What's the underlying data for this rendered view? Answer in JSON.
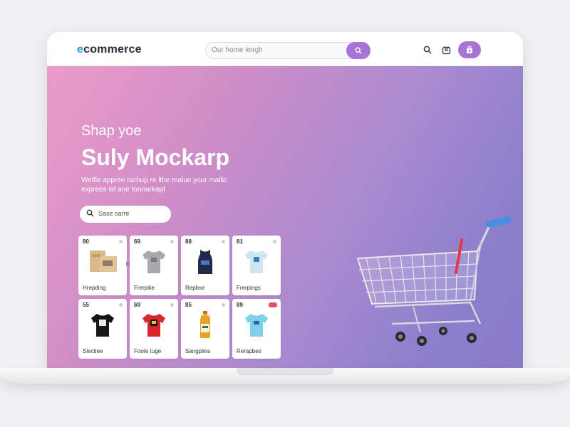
{
  "header": {
    "logo_prefix": "e",
    "logo_rest": "commerce",
    "search_placeholder": "Our home leirgh"
  },
  "hero": {
    "subtitle": "Shap yoe",
    "title": "Suly Mockarp",
    "description": "Welfie appree Ischup re lthe malue your mallic exprees ist ane tonnarkapt",
    "search_placeholder": "Sase sarre"
  },
  "products": [
    {
      "price": "80",
      "name": "Hrepding",
      "image": "box-icon",
      "badge": false
    },
    {
      "price": "69",
      "name": "Frerpilie",
      "image": "gray-tshirt-icon",
      "badge": false
    },
    {
      "price": "88",
      "name": "Repbse",
      "image": "navy-tank-icon",
      "badge": false
    },
    {
      "price": "81",
      "name": "Frerpings",
      "image": "light-tshirt-icon",
      "badge": false
    },
    {
      "price": "55",
      "name": "Slectiee",
      "image": "black-tshirt-icon",
      "badge": false
    },
    {
      "price": "69",
      "name": "Foote tuge",
      "image": "red-tshirt-icon",
      "badge": false
    },
    {
      "price": "85",
      "name": "Sangplies",
      "image": "bottle-icon",
      "badge": false
    },
    {
      "price": "89",
      "name": "Rerapbes",
      "image": "cyan-tshirt-icon",
      "badge": true
    }
  ],
  "colors": {
    "accent": "#a774d6",
    "logo_accent": "#2aa6d8",
    "hero_start": "#ea9cc9",
    "hero_end": "#8a7bc9"
  }
}
